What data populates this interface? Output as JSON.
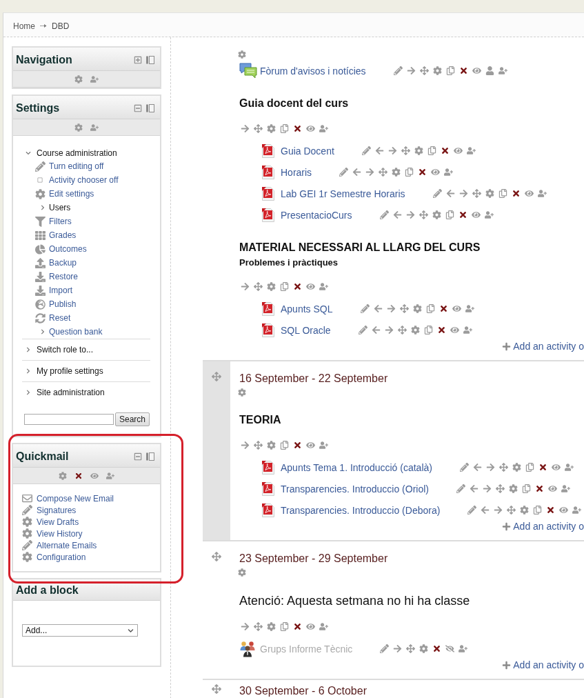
{
  "breadcrumb": [
    "Home",
    "DBD"
  ],
  "blocks": [
    {
      "kind": "core",
      "title": "Navigation",
      "collapsed": true,
      "highlighted": false
    },
    {
      "kind": "core",
      "title": "Settings",
      "collapsed": false,
      "highlighted": false,
      "tree": [
        {
          "label": "Course administration",
          "kind": "branch",
          "expanded": true,
          "children": [
            {
              "label": "Turn editing off",
              "kind": "link"
            },
            {
              "label": "Activity chooser off",
              "kind": "link"
            },
            {
              "label": "Edit settings",
              "kind": "link"
            },
            {
              "label": "Users",
              "kind": "branch",
              "expanded": false
            },
            {
              "label": "Filters",
              "kind": "link"
            },
            {
              "label": "Grades",
              "kind": "link"
            },
            {
              "label": "Outcomes",
              "kind": "link"
            },
            {
              "label": "Backup",
              "kind": "link"
            },
            {
              "label": "Restore",
              "kind": "link"
            },
            {
              "label": "Import",
              "kind": "link"
            },
            {
              "label": "Publish",
              "kind": "link"
            },
            {
              "label": "Reset",
              "kind": "link"
            },
            {
              "label": "Question bank",
              "kind": "link-branch",
              "expanded": false
            }
          ]
        },
        {
          "label": "Switch role to...",
          "kind": "branch",
          "expanded": false
        },
        {
          "label": "My profile settings",
          "kind": "branch",
          "expanded": false
        },
        {
          "label": "Site administration",
          "kind": "branch",
          "expanded": false
        }
      ],
      "search": {
        "button": "Search"
      }
    },
    {
      "kind": "plugin",
      "title": "Quickmail",
      "collapsed": false,
      "highlighted": true,
      "items": [
        "Compose New Email",
        "Signatures",
        "View Drafts",
        "View History",
        "Alternate Emails",
        "Configuration"
      ]
    },
    {
      "kind": "add",
      "title": "Add a block",
      "highlighted": false,
      "select": {
        "value": "Add..."
      }
    }
  ],
  "sections": [
    {
      "current": false,
      "movable": false,
      "activities": [
        {
          "kind": "forum",
          "name": "Fòrum d'avisos i notícies",
          "hidden": false
        },
        {
          "kind": "label",
          "hidden": false,
          "lines": [
            {
              "kind": "heading",
              "text": "Guia docent del curs"
            }
          ],
          "children": [
            {
              "kind": "pdf",
              "name": "Guia Docent",
              "hidden": false
            },
            {
              "kind": "pdf",
              "name": "Horaris",
              "hidden": false
            },
            {
              "kind": "pdf",
              "name": "Lab GEI 1r Semestre Horaris",
              "hidden": false
            },
            {
              "kind": "pdf",
              "name": "PresentacioCurs",
              "hidden": false
            }
          ]
        },
        {
          "kind": "label",
          "hidden": false,
          "lines": [
            {
              "kind": "heading",
              "text": "MATERIAL NECESSARI AL LLARG DEL CURS"
            },
            {
              "kind": "subheading",
              "text": "Problemes i pràctiques"
            }
          ],
          "children": [
            {
              "kind": "pdf",
              "name": "Apunts SQL",
              "hidden": false
            },
            {
              "kind": "pdf",
              "name": "SQL Oracle",
              "hidden": false
            }
          ]
        }
      ],
      "add_link": "Add an activity o"
    },
    {
      "title": "16 September - 22 September",
      "current": true,
      "movable": true,
      "activities": [
        {
          "kind": "label",
          "hidden": false,
          "lines": [
            {
              "kind": "heading",
              "text": "TEORIA"
            }
          ],
          "children": [
            {
              "kind": "pdf",
              "name": "Apunts Tema 1. Introducció (català)",
              "hidden": false
            },
            {
              "kind": "pdf",
              "name": "Transparencies. Introduccio (Oriol)",
              "hidden": false
            },
            {
              "kind": "pdf",
              "name": "Transparencies. Introduccio (Debora)",
              "hidden": false
            }
          ]
        }
      ],
      "add_link": "Add an activity o"
    },
    {
      "title": "23 September - 29 September",
      "current": false,
      "movable": true,
      "activities": [
        {
          "kind": "label",
          "hidden": false,
          "lines": [
            {
              "kind": "large",
              "text": "Atenció: Aquesta setmana no hi ha classe"
            }
          ]
        },
        {
          "kind": "groups",
          "name": "Grups Informe Tècnic",
          "hidden": true
        }
      ],
      "add_link": "Add an activity o"
    },
    {
      "title": "30 September - 6 October",
      "current": false,
      "movable": true
    }
  ]
}
